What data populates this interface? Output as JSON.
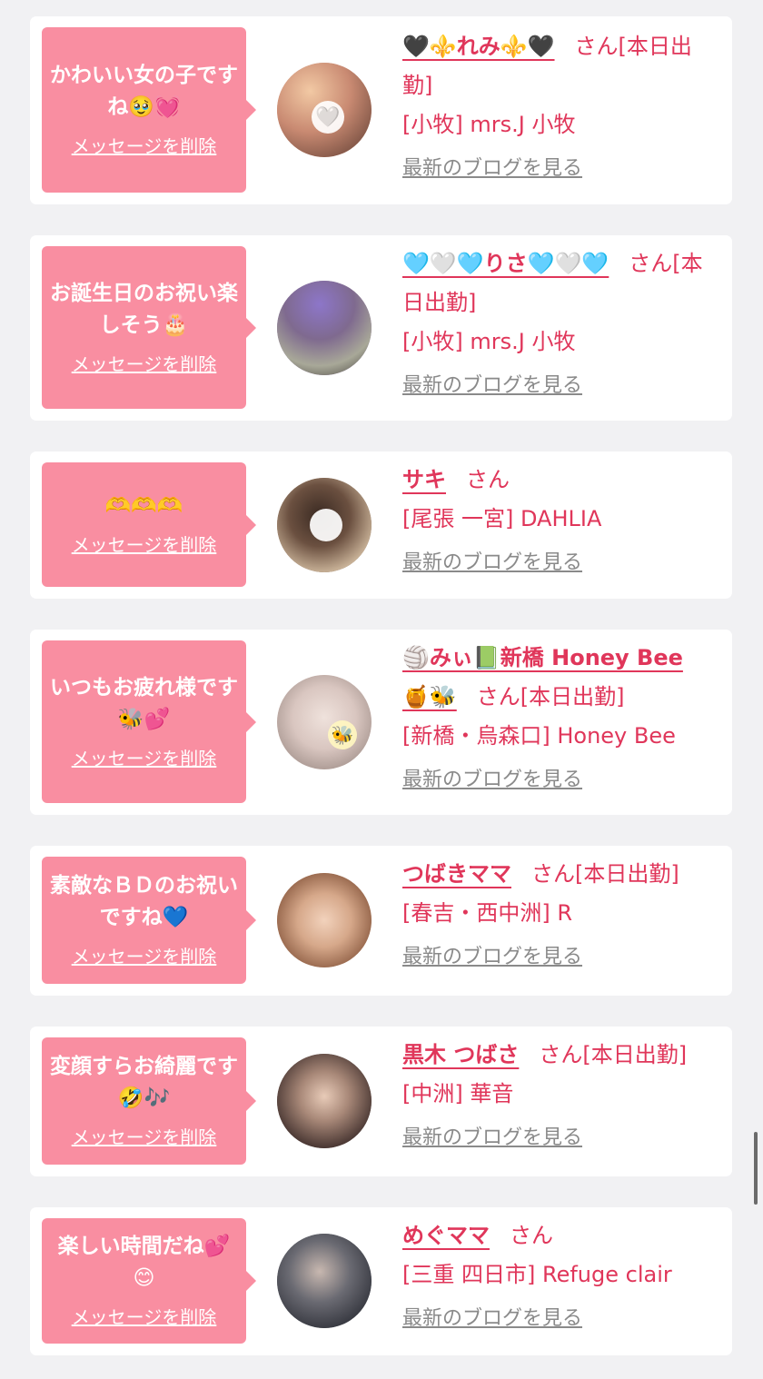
{
  "delete_label": "メッセージを削除",
  "blog_label": "最新のブログを見る",
  "honorific": "さん",
  "items": [
    {
      "message": "かわいい女の子ですね🥹💓",
      "name": "🖤⚜️れみ⚜️🖤",
      "status": "[本日出勤]",
      "shop": "[小牧] mrs.J 小牧",
      "avatar_color": "#c98a72"
    },
    {
      "message": "お誕生日のお祝い楽しそう🎂",
      "name": "🩵🤍🩵りさ🩵🤍🩵",
      "status": "[本日出勤]",
      "shop": "[小牧] mrs.J 小牧",
      "avatar_color": "#7f6a8f"
    },
    {
      "message": "🫶🫶🫶",
      "name": "サキ",
      "status": "",
      "shop": "[尾張 一宮] DAHLIA",
      "avatar_color": "#8a6b4f"
    },
    {
      "message": "いつもお疲れ様です🐝💕",
      "name": "🏐みぃ📗新橋 Honey Bee 🍯🐝",
      "status": "[本日出勤]",
      "shop": "[新橋・烏森口] Honey Bee",
      "avatar_color": "#d9c6c0"
    },
    {
      "message": "素敵なＢＤのお祝いですね💙",
      "name": "つばきママ",
      "status": "[本日出勤]",
      "shop": "[春吉・西中洲] R",
      "avatar_color": "#b88a6e"
    },
    {
      "message": "変顔すらお綺麗です🤣🎶",
      "name": "黒木 つばさ",
      "status": "[本日出勤]",
      "shop": "[中洲] 華音",
      "avatar_color": "#5e4a44"
    },
    {
      "message": "楽しい時間だね💕😊",
      "name": "めぐママ",
      "status": "",
      "shop": "[三重 四日市] Refuge clair",
      "avatar_color": "#4c4f57"
    }
  ]
}
